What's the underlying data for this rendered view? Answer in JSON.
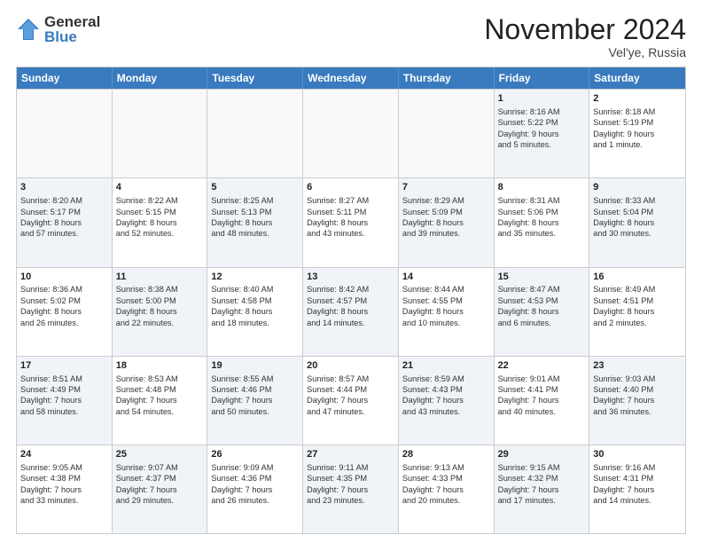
{
  "logo": {
    "general": "General",
    "blue": "Blue"
  },
  "title": "November 2024",
  "location": "Vel'ye, Russia",
  "days_of_week": [
    "Sunday",
    "Monday",
    "Tuesday",
    "Wednesday",
    "Thursday",
    "Friday",
    "Saturday"
  ],
  "rows": [
    [
      {
        "day": "",
        "info": "",
        "empty": true
      },
      {
        "day": "",
        "info": "",
        "empty": true
      },
      {
        "day": "",
        "info": "",
        "empty": true
      },
      {
        "day": "",
        "info": "",
        "empty": true
      },
      {
        "day": "",
        "info": "",
        "empty": true
      },
      {
        "day": "1",
        "info": "Sunrise: 8:16 AM\nSunset: 5:22 PM\nDaylight: 9 hours\nand 5 minutes.",
        "shaded": true
      },
      {
        "day": "2",
        "info": "Sunrise: 8:18 AM\nSunset: 5:19 PM\nDaylight: 9 hours\nand 1 minute.",
        "shaded": false
      }
    ],
    [
      {
        "day": "3",
        "info": "Sunrise: 8:20 AM\nSunset: 5:17 PM\nDaylight: 8 hours\nand 57 minutes.",
        "shaded": true
      },
      {
        "day": "4",
        "info": "Sunrise: 8:22 AM\nSunset: 5:15 PM\nDaylight: 8 hours\nand 52 minutes.",
        "shaded": false
      },
      {
        "day": "5",
        "info": "Sunrise: 8:25 AM\nSunset: 5:13 PM\nDaylight: 8 hours\nand 48 minutes.",
        "shaded": true
      },
      {
        "day": "6",
        "info": "Sunrise: 8:27 AM\nSunset: 5:11 PM\nDaylight: 8 hours\nand 43 minutes.",
        "shaded": false
      },
      {
        "day": "7",
        "info": "Sunrise: 8:29 AM\nSunset: 5:09 PM\nDaylight: 8 hours\nand 39 minutes.",
        "shaded": true
      },
      {
        "day": "8",
        "info": "Sunrise: 8:31 AM\nSunset: 5:06 PM\nDaylight: 8 hours\nand 35 minutes.",
        "shaded": false
      },
      {
        "day": "9",
        "info": "Sunrise: 8:33 AM\nSunset: 5:04 PM\nDaylight: 8 hours\nand 30 minutes.",
        "shaded": true
      }
    ],
    [
      {
        "day": "10",
        "info": "Sunrise: 8:36 AM\nSunset: 5:02 PM\nDaylight: 8 hours\nand 26 minutes.",
        "shaded": false
      },
      {
        "day": "11",
        "info": "Sunrise: 8:38 AM\nSunset: 5:00 PM\nDaylight: 8 hours\nand 22 minutes.",
        "shaded": true
      },
      {
        "day": "12",
        "info": "Sunrise: 8:40 AM\nSunset: 4:58 PM\nDaylight: 8 hours\nand 18 minutes.",
        "shaded": false
      },
      {
        "day": "13",
        "info": "Sunrise: 8:42 AM\nSunset: 4:57 PM\nDaylight: 8 hours\nand 14 minutes.",
        "shaded": true
      },
      {
        "day": "14",
        "info": "Sunrise: 8:44 AM\nSunset: 4:55 PM\nDaylight: 8 hours\nand 10 minutes.",
        "shaded": false
      },
      {
        "day": "15",
        "info": "Sunrise: 8:47 AM\nSunset: 4:53 PM\nDaylight: 8 hours\nand 6 minutes.",
        "shaded": true
      },
      {
        "day": "16",
        "info": "Sunrise: 8:49 AM\nSunset: 4:51 PM\nDaylight: 8 hours\nand 2 minutes.",
        "shaded": false
      }
    ],
    [
      {
        "day": "17",
        "info": "Sunrise: 8:51 AM\nSunset: 4:49 PM\nDaylight: 7 hours\nand 58 minutes.",
        "shaded": true
      },
      {
        "day": "18",
        "info": "Sunrise: 8:53 AM\nSunset: 4:48 PM\nDaylight: 7 hours\nand 54 minutes.",
        "shaded": false
      },
      {
        "day": "19",
        "info": "Sunrise: 8:55 AM\nSunset: 4:46 PM\nDaylight: 7 hours\nand 50 minutes.",
        "shaded": true
      },
      {
        "day": "20",
        "info": "Sunrise: 8:57 AM\nSunset: 4:44 PM\nDaylight: 7 hours\nand 47 minutes.",
        "shaded": false
      },
      {
        "day": "21",
        "info": "Sunrise: 8:59 AM\nSunset: 4:43 PM\nDaylight: 7 hours\nand 43 minutes.",
        "shaded": true
      },
      {
        "day": "22",
        "info": "Sunrise: 9:01 AM\nSunset: 4:41 PM\nDaylight: 7 hours\nand 40 minutes.",
        "shaded": false
      },
      {
        "day": "23",
        "info": "Sunrise: 9:03 AM\nSunset: 4:40 PM\nDaylight: 7 hours\nand 36 minutes.",
        "shaded": true
      }
    ],
    [
      {
        "day": "24",
        "info": "Sunrise: 9:05 AM\nSunset: 4:38 PM\nDaylight: 7 hours\nand 33 minutes.",
        "shaded": false
      },
      {
        "day": "25",
        "info": "Sunrise: 9:07 AM\nSunset: 4:37 PM\nDaylight: 7 hours\nand 29 minutes.",
        "shaded": true
      },
      {
        "day": "26",
        "info": "Sunrise: 9:09 AM\nSunset: 4:36 PM\nDaylight: 7 hours\nand 26 minutes.",
        "shaded": false
      },
      {
        "day": "27",
        "info": "Sunrise: 9:11 AM\nSunset: 4:35 PM\nDaylight: 7 hours\nand 23 minutes.",
        "shaded": true
      },
      {
        "day": "28",
        "info": "Sunrise: 9:13 AM\nSunset: 4:33 PM\nDaylight: 7 hours\nand 20 minutes.",
        "shaded": false
      },
      {
        "day": "29",
        "info": "Sunrise: 9:15 AM\nSunset: 4:32 PM\nDaylight: 7 hours\nand 17 minutes.",
        "shaded": true
      },
      {
        "day": "30",
        "info": "Sunrise: 9:16 AM\nSunset: 4:31 PM\nDaylight: 7 hours\nand 14 minutes.",
        "shaded": false
      }
    ]
  ]
}
